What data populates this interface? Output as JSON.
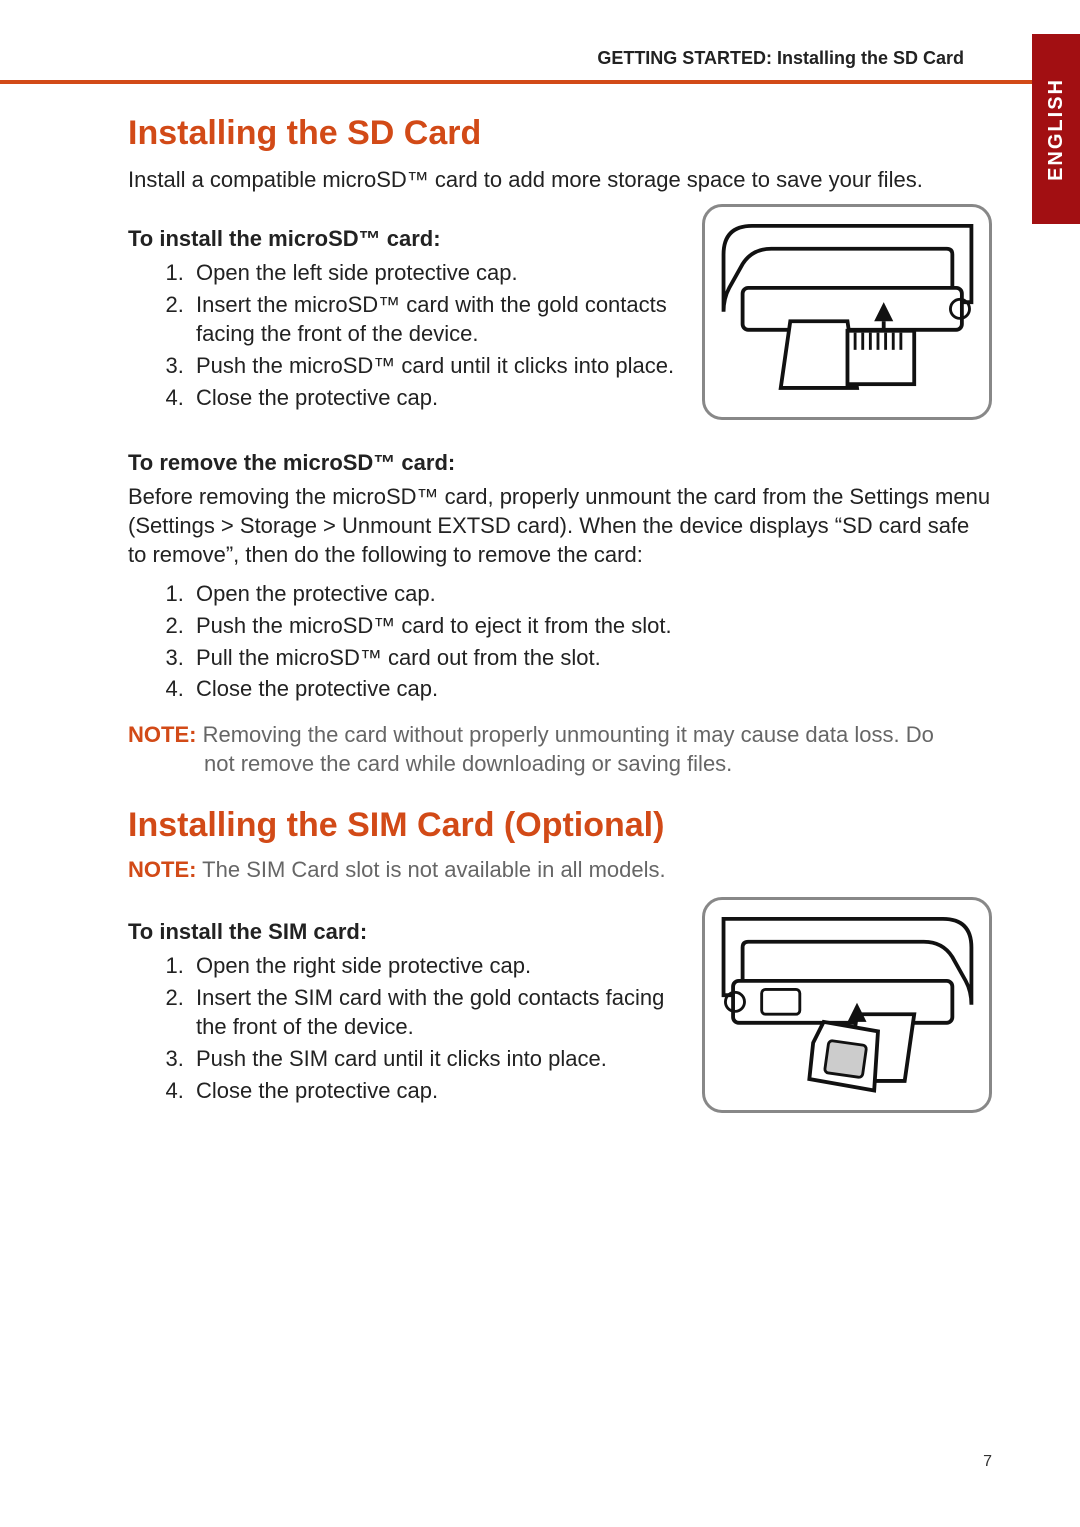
{
  "header": "GETTING STARTED: Installing the SD Card",
  "language_tab": "ENGLISH",
  "page_number": "7",
  "section1": {
    "title": "Installing the SD Card",
    "intro": "Install a compatible microSD™ card to add more storage space to save your files.",
    "install": {
      "heading": "To install the microSD™ card:",
      "steps": [
        "Open the left side protective cap.",
        "Insert the microSD™ card with the gold contacts facing the front of the device.",
        "Push the microSD™ card until it clicks into place.",
        "Close the protective cap."
      ]
    },
    "remove": {
      "heading": "To remove the microSD™ card:",
      "intro": "Before removing the microSD™ card, properly unmount the card from the Settings menu (Settings > Storage > Unmount EXTSD card). When the device displays “SD card safe to remove”, then do the following to remove the card:",
      "steps": [
        "Open the protective cap.",
        "Push the microSD™ card to eject it from the slot.",
        "Pull the microSD™ card out from the slot.",
        "Close the protective cap."
      ]
    },
    "note": {
      "label": "NOTE:",
      "line1": " Removing the card without properly unmounting it may cause data loss. Do",
      "line2": "not remove the card while downloading or saving files."
    }
  },
  "section2": {
    "title": "Installing the SIM Card (Optional)",
    "note": {
      "label": "NOTE:",
      "text": " The SIM Card slot is not available in all models."
    },
    "install": {
      "heading": "To install the SIM card:",
      "steps": [
        "Open the right side protective cap.",
        "Insert the SIM card with the gold contacts facing the front of the device.",
        "Push the SIM card until it clicks into place.",
        "Close the protective cap."
      ]
    }
  }
}
